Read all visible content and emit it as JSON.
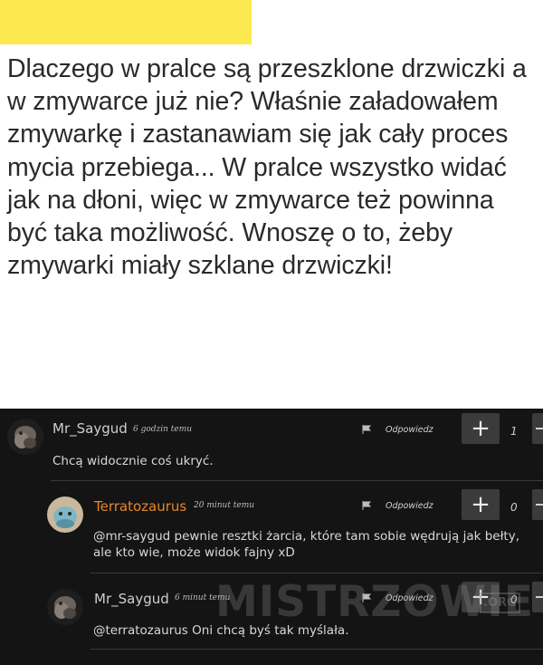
{
  "post": {
    "text": "Dlaczego w pralce są przeszklone drzwiczki a w zmywarce już nie? Właśnie załadowałem zmywarkę i zastanawiam się jak cały proces mycia przebiega... W pralce wszystko widać jak na dłoni, więc w zmywarce też powinna być taka możliwość. Wnoszę o to, żeby zmywarki miały szklane drzwiczki!"
  },
  "comments": [
    {
      "author": "Mr_Saygud",
      "time": "6 godzin temu",
      "reply_label": "Odpowiedz",
      "upvote_label": "+",
      "score": "1",
      "text": "Chcą widocznie coś ukryć."
    },
    {
      "author": "Terratozaurus",
      "time": "20 minut temu",
      "reply_label": "Odpowiedz",
      "upvote_label": "+",
      "score": "0",
      "mention": "@mr-saygud",
      "text": " pewnie resztki żarcia, które tam sobie wędrują jak bełty, ale kto wie, może widok fajny xD"
    },
    {
      "author": "Mr_Saygud",
      "time": "6 minut temu",
      "reply_label": "Odpowiedz",
      "upvote_label": "+",
      "score": "0",
      "mention": "@terratozaurus",
      "text": " Oni chcą byś tak myślała."
    }
  ],
  "watermark": {
    "text": "MISTRZOWIE",
    "suffix": ".ORG"
  },
  "colors": {
    "highlight": "#fce94f",
    "dark_bg": "#141414",
    "author_orange": "#e8862a",
    "button_bg": "#3b3b3b"
  }
}
